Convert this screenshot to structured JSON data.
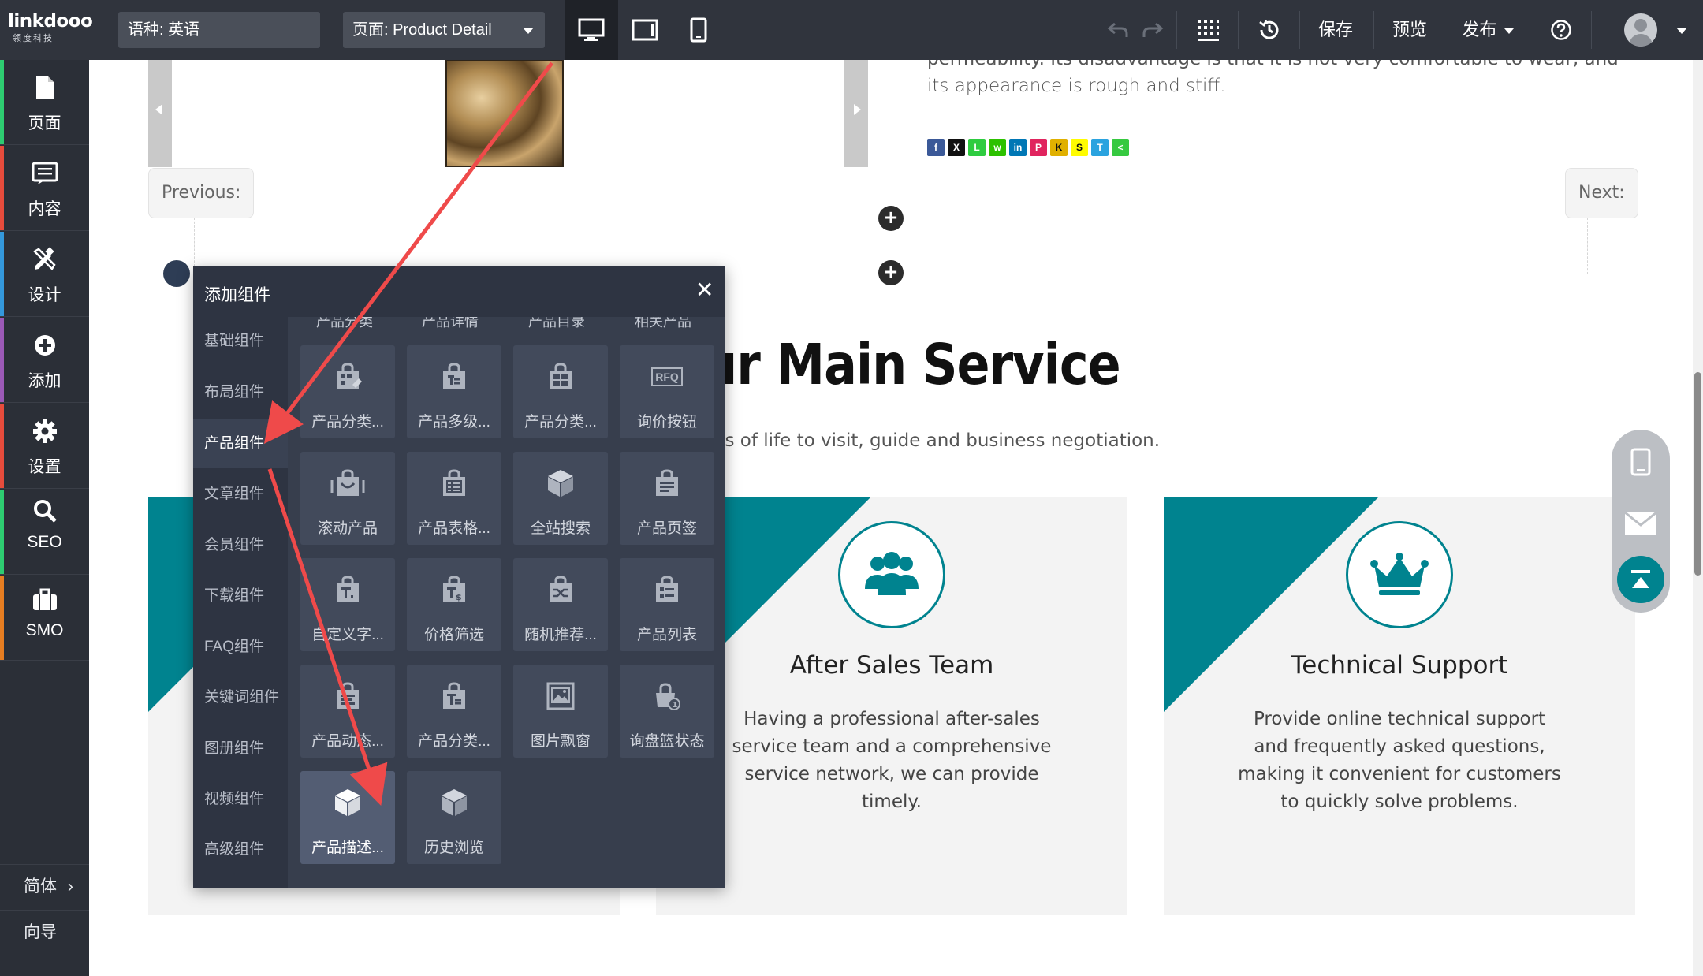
{
  "app": {
    "logo_main": "linkdooo",
    "logo_sub": "领度科技",
    "language_field": "语种: 英语",
    "page_field": "页面: Product Detail",
    "save_label": "保存",
    "preview_label": "预览",
    "publish_label": "发布"
  },
  "sidebar": {
    "items": [
      {
        "label": "页面",
        "icon": "page-icon",
        "color": "#2ecc71"
      },
      {
        "label": "内容",
        "icon": "content-icon",
        "color": "#e74c3c"
      },
      {
        "label": "设计",
        "icon": "design-icon",
        "color": "#3498db"
      },
      {
        "label": "添加",
        "icon": "add-icon",
        "color": "#9b59b6"
      },
      {
        "label": "设置",
        "icon": "settings-icon",
        "color": "#e74c3c"
      },
      {
        "label": "SEO",
        "icon": "search-icon",
        "color": "#2ecc71"
      },
      {
        "label": "SMO",
        "icon": "briefcase-icon",
        "color": "#e67e22"
      }
    ],
    "locale_label": "简体",
    "guide_label": "向导"
  },
  "canvas": {
    "desc_cut": "permeability. Its disadvantage is that it is not very comfortable to wear, and",
    "desc_line": "its appearance is rough and stiff.",
    "prev_label": "Previous:",
    "next_label": "Next:",
    "service_title": "Our Main Service",
    "service_sub": "om all walks of life to visit, guide and business negotiation.",
    "cards": [
      {
        "title": "After Sales Team",
        "text": "Having a professional after-sales service team and a comprehensive service network, we can provide timely."
      },
      {
        "title": "Technical Support",
        "text": "Provide online technical support and frequently asked questions, making it convenient for customers to quickly solve problems."
      }
    ],
    "accent": "#00838f"
  },
  "panel": {
    "title": "添加组件",
    "categories": [
      "基础组件",
      "布局组件",
      "产品组件",
      "文章组件",
      "会员组件",
      "下载组件",
      "FAQ组件",
      "关键词组件",
      "图册组件",
      "视频组件",
      "高级组件"
    ],
    "active_category": "产品组件",
    "cut_row": [
      "产品分类",
      "产品详情",
      "产品目录",
      "相关产品"
    ],
    "tiles": [
      {
        "label": "产品分类...",
        "icon": "category-icon"
      },
      {
        "label": "产品多级...",
        "icon": "multilevel-icon"
      },
      {
        "label": "产品分类...",
        "icon": "category-grid-icon"
      },
      {
        "label": "询价按钮",
        "icon": "rfq-icon",
        "badge": "RFQ"
      },
      {
        "label": "滚动产品",
        "icon": "scroll-product-icon"
      },
      {
        "label": "产品表格...",
        "icon": "table-icon"
      },
      {
        "label": "全站搜索",
        "icon": "box-icon"
      },
      {
        "label": "产品页签",
        "icon": "tab-icon"
      },
      {
        "label": "自定义字...",
        "icon": "custom-field-icon"
      },
      {
        "label": "价格筛选",
        "icon": "price-filter-icon"
      },
      {
        "label": "随机推荐...",
        "icon": "shuffle-icon"
      },
      {
        "label": "产品列表",
        "icon": "list-icon"
      },
      {
        "label": "产品动态...",
        "icon": "dynamic-icon"
      },
      {
        "label": "产品分类...",
        "icon": "category-list-icon"
      },
      {
        "label": "图片飘窗",
        "icon": "image-icon"
      },
      {
        "label": "询盘篮状态",
        "icon": "basket-icon"
      },
      {
        "label": "产品描述...",
        "icon": "cube-icon"
      },
      {
        "label": "历史浏览",
        "icon": "history-cube-icon"
      }
    ]
  }
}
